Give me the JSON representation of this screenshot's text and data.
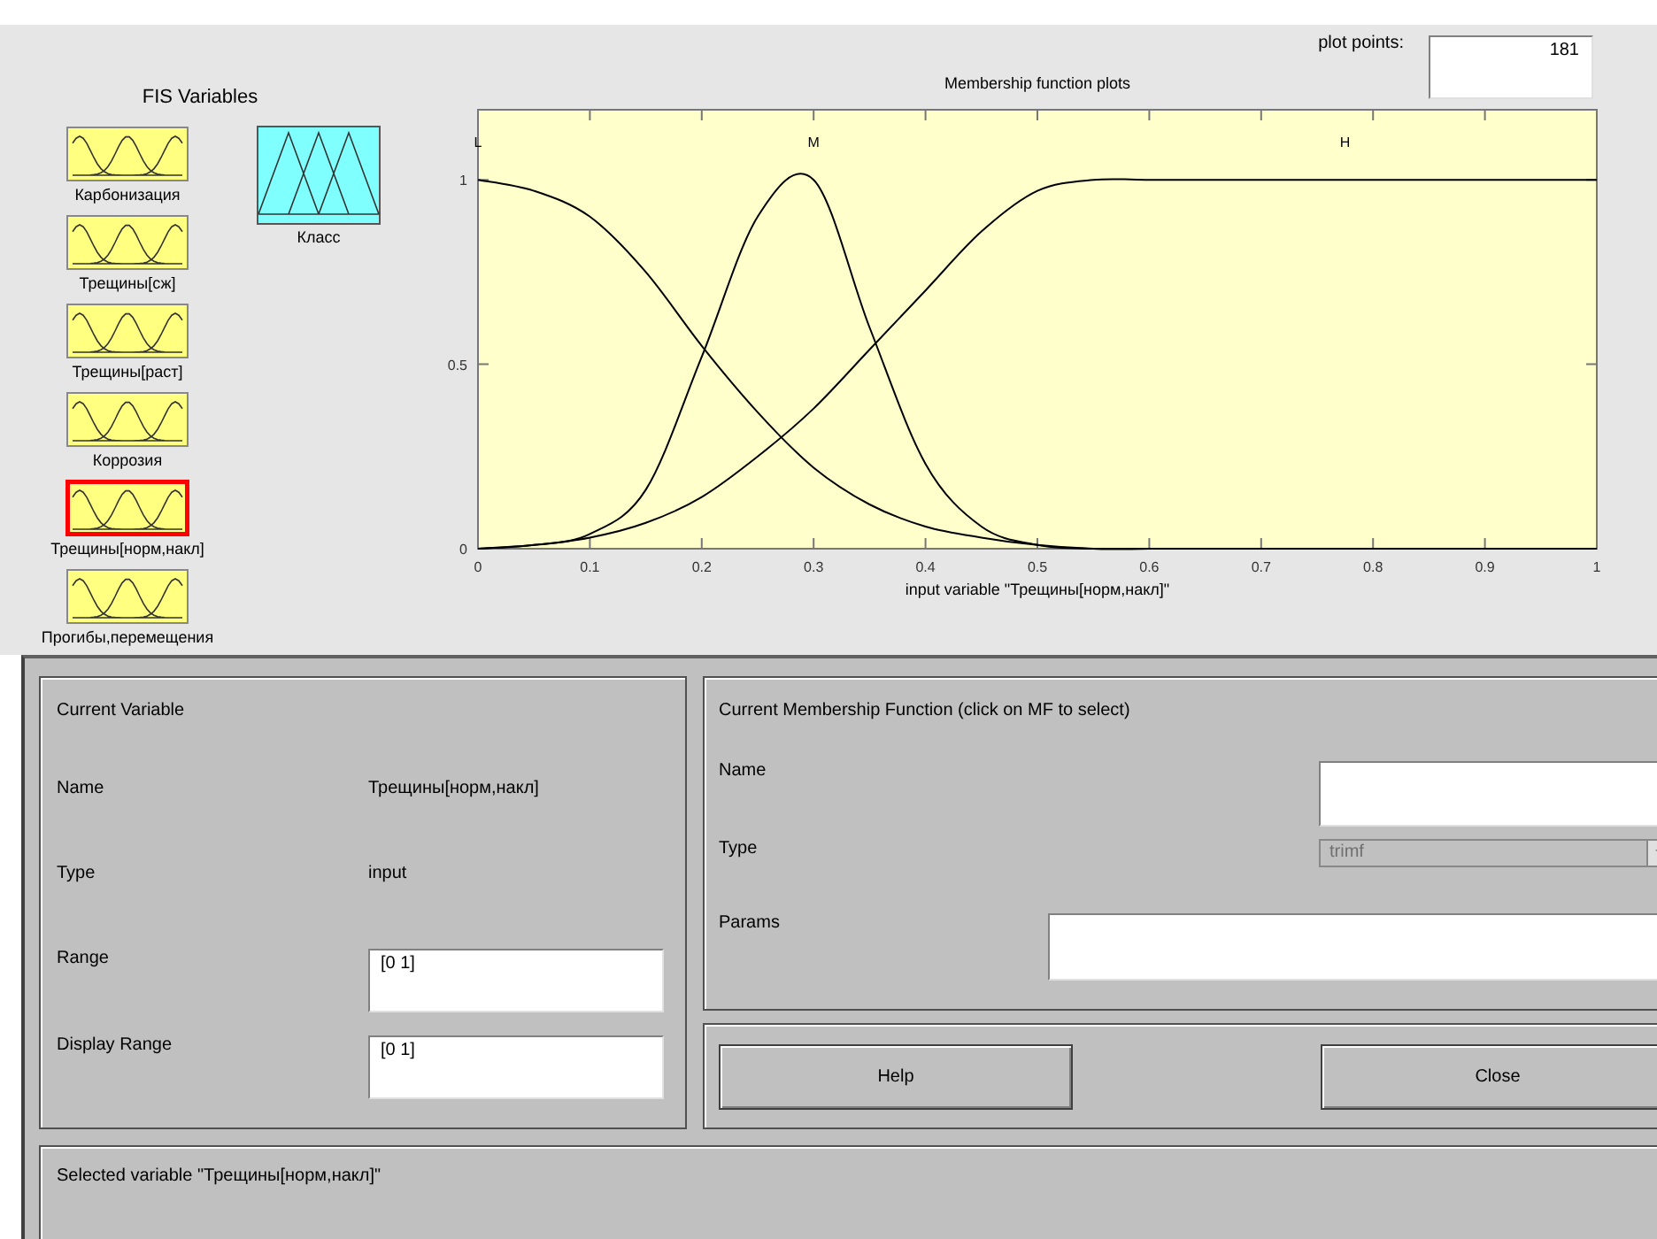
{
  "fis_variables": {
    "title": "FIS Variables",
    "items": [
      {
        "name": "Карбонизация",
        "kind": "input",
        "selected": false
      },
      {
        "name": "Трещины[сж]",
        "kind": "input",
        "selected": false
      },
      {
        "name": "Трещины[раст]",
        "kind": "input",
        "selected": false
      },
      {
        "name": "Коррозия",
        "kind": "input",
        "selected": false
      },
      {
        "name": "Трещины[норм,накл]",
        "kind": "input",
        "selected": true
      },
      {
        "name": "Прогибы,перемещения",
        "kind": "input",
        "selected": false
      },
      {
        "name": "Класс",
        "kind": "output",
        "selected": false
      }
    ]
  },
  "plot_points": {
    "label": "plot points:",
    "value": "181"
  },
  "mf_plot": {
    "chart_data": {
      "type": "line",
      "title": "Membership function plots",
      "xlabel": "input variable \"Трещины[норм,накл]\"",
      "x": [
        0,
        0.05,
        0.1,
        0.15,
        0.2,
        0.25,
        0.3,
        0.35,
        0.4,
        0.45,
        0.5,
        0.55,
        0.6,
        0.65,
        0.7,
        0.75,
        0.8,
        0.85,
        0.9,
        0.95,
        1
      ],
      "series": [
        {
          "name": "L",
          "color": "#000000",
          "values": [
            1,
            0.97,
            0.9,
            0.75,
            0.55,
            0.37,
            0.22,
            0.12,
            0.06,
            0.03,
            0.01,
            0,
            0,
            0,
            0,
            0,
            0,
            0,
            0,
            0,
            0
          ]
        },
        {
          "name": "M",
          "color": "#000000",
          "values": [
            0,
            0.01,
            0.04,
            0.16,
            0.52,
            0.9,
            1,
            0.6,
            0.23,
            0.06,
            0.01,
            0,
            0,
            0,
            0,
            0,
            0,
            0,
            0,
            0,
            0
          ]
        },
        {
          "name": "H",
          "color": "#000000",
          "values": [
            0,
            0.01,
            0.03,
            0.07,
            0.14,
            0.25,
            0.38,
            0.54,
            0.7,
            0.86,
            0.97,
            1,
            1,
            1,
            1,
            1,
            1,
            1,
            1,
            1,
            1
          ]
        }
      ],
      "xlim": [
        0,
        1
      ],
      "ylim": [
        0,
        1.19
      ],
      "xticks": [
        0,
        0.1,
        0.2,
        0.3,
        0.4,
        0.5,
        0.6,
        0.7,
        0.8,
        0.9,
        1
      ],
      "yticks": [
        0,
        0.5,
        1
      ]
    }
  },
  "current_variable": {
    "title": "Current Variable",
    "name_label": "Name",
    "name": "Трещины[норм,накл]",
    "type_label": "Type",
    "type": "input",
    "range_label": "Range",
    "range": "[0 1]",
    "display_range_label": "Display Range",
    "display_range": "[0 1]"
  },
  "current_mf": {
    "title": "Current Membership Function (click on MF to select)",
    "name_label": "Name",
    "type_label": "Type",
    "type": {
      "value": "trimf",
      "disabled": true
    },
    "params_label": "Params"
  },
  "buttons": [
    "Help",
    "Close"
  ],
  "status": "Selected variable \"Трещины[норм,накл]\""
}
